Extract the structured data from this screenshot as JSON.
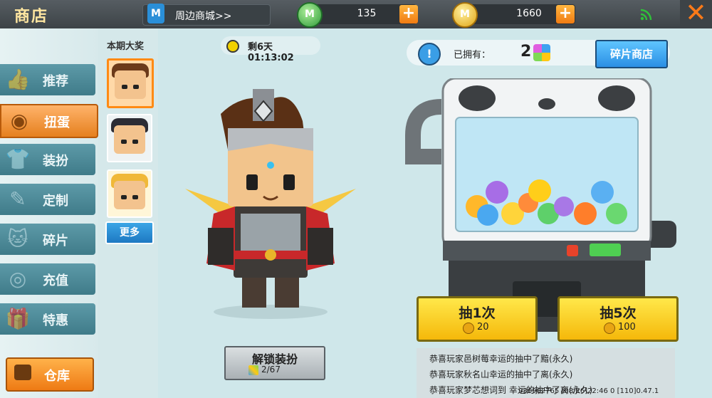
{
  "header": {
    "title": "商店",
    "mall_link": "周边商城>>",
    "mall_icon_letter": "M",
    "gems": "135",
    "coins": "1660",
    "currency_icon_letter": "M",
    "plus": "+",
    "close": "✕"
  },
  "sidebar": {
    "items": [
      {
        "label": "推荐",
        "icon": "thumbs-up-icon",
        "glyph": "👍"
      },
      {
        "label": "扭蛋",
        "icon": "capsule-icon",
        "glyph": "◉"
      },
      {
        "label": "装扮",
        "icon": "shirt-icon",
        "glyph": "👕"
      },
      {
        "label": "定制",
        "icon": "brush-icon",
        "glyph": "✎"
      },
      {
        "label": "碎片",
        "icon": "cat-icon",
        "glyph": "🐱"
      },
      {
        "label": "充值",
        "icon": "coin-stack-icon",
        "glyph": "◎"
      },
      {
        "label": "特惠",
        "icon": "gift-icon",
        "glyph": "🎁"
      }
    ],
    "active_index": 1,
    "warehouse": "仓库"
  },
  "prize_column": {
    "title": "本期大奖",
    "more": "更多"
  },
  "timer": "剩6天 01:13:02",
  "unlock": {
    "label": "解锁装扮",
    "progress": "2/67"
  },
  "info": {
    "icon": "!",
    "owned_label": "已拥有：",
    "owned_count": "2",
    "fragment_shop": "碎片商店"
  },
  "draw": [
    {
      "label": "抽1次",
      "price": "20"
    },
    {
      "label": "抽5次",
      "price": "100"
    }
  ],
  "feed": [
    "恭喜玩家邑树莓幸运的抽中了黯(永久)",
    "恭喜玩家秋名山幸运的抽中了离(永久)",
    "恭喜玩家梦芯想词到 幸运的抽中了离(永久)"
  ],
  "footer": "936902765    [08/26]22:46 0 [110]0.47.1",
  "colors": {
    "accent": "#ff8a14",
    "active_tab": "#e5801f",
    "draw_button": "#f5c814"
  }
}
